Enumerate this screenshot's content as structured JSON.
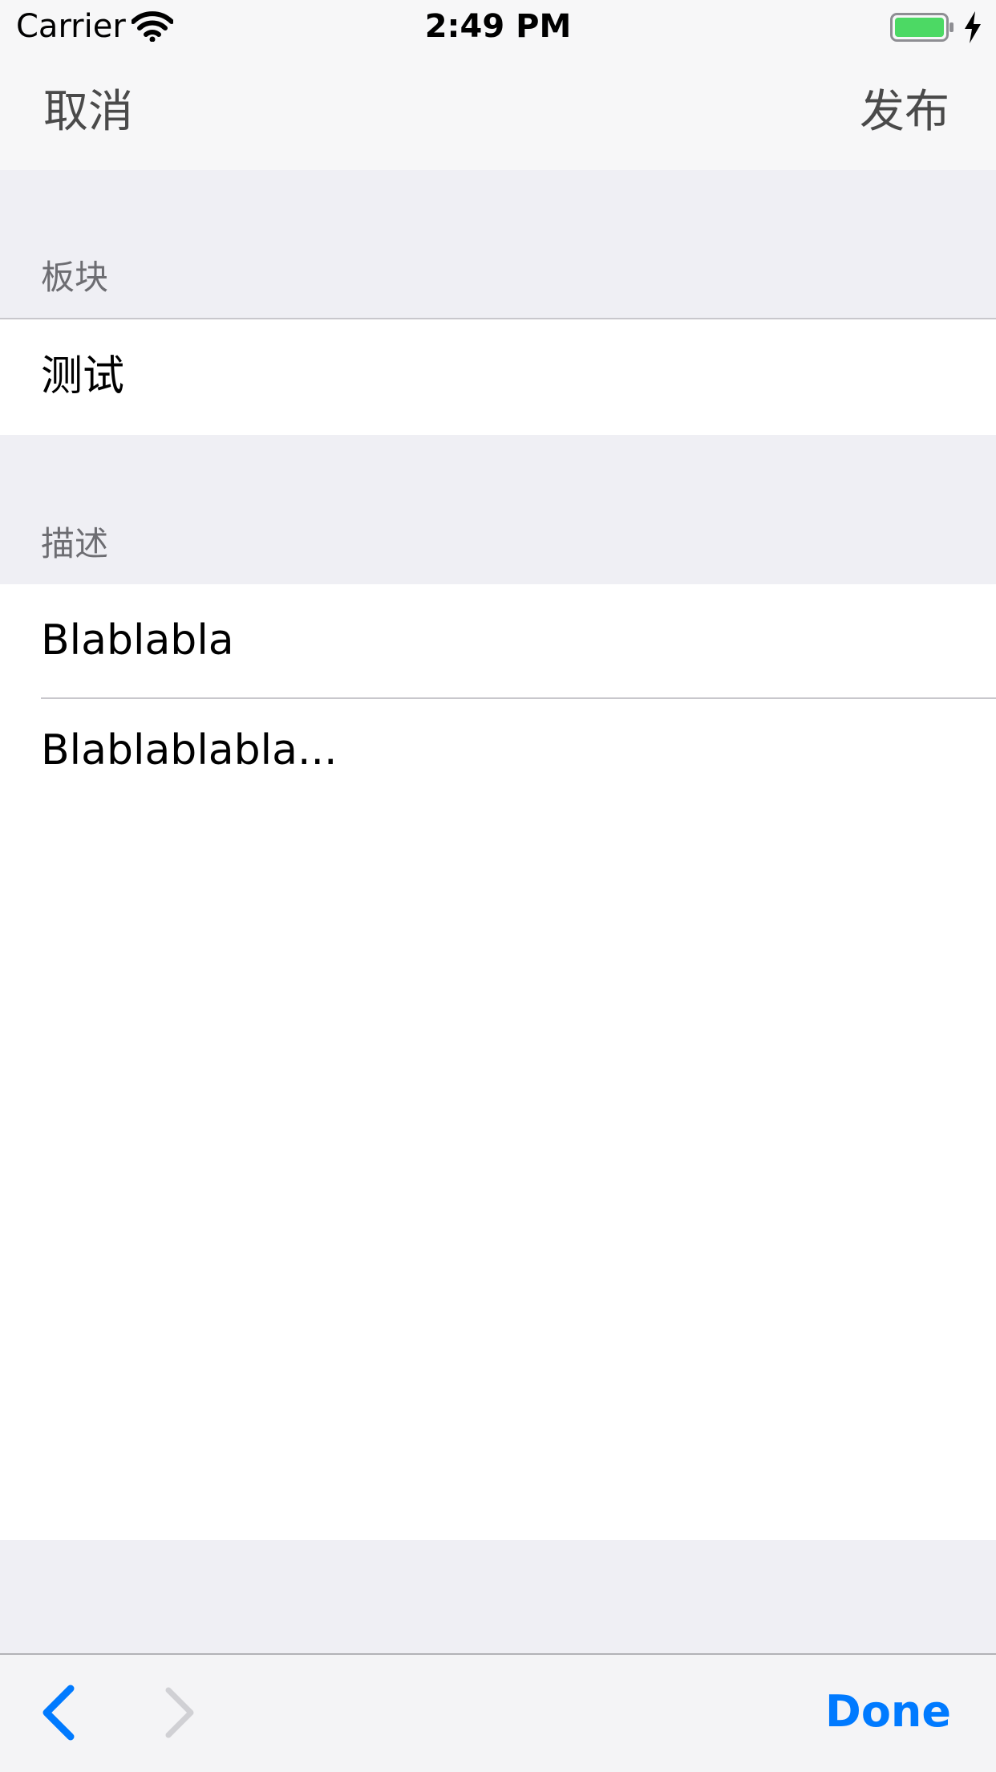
{
  "status_bar": {
    "carrier": "Carrier",
    "time": "2:49 PM",
    "battery_color": "#4cd964"
  },
  "nav": {
    "cancel_label": "取消",
    "publish_label": "发布"
  },
  "sections": {
    "board": {
      "header": "板块",
      "value": "测试"
    },
    "description": {
      "header": "描述",
      "title_value": "Blablabla",
      "body_value": "Blablablabla..."
    }
  },
  "toolbar": {
    "done_label": "Done",
    "accent_color": "#007aff",
    "disabled_color": "#c7c7cc"
  }
}
